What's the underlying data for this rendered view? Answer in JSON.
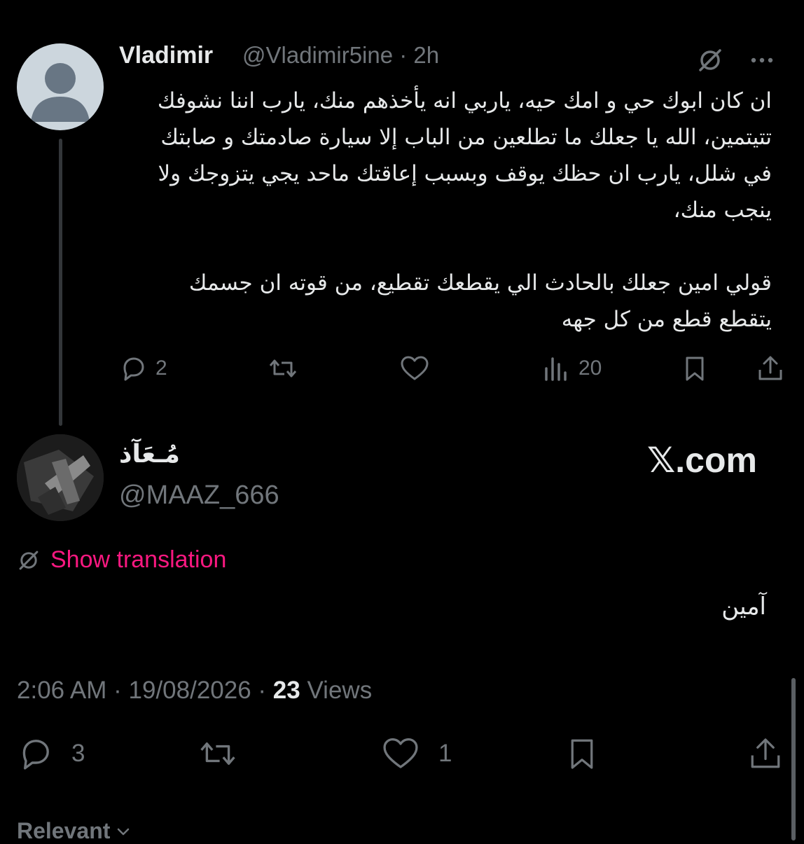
{
  "original_tweet": {
    "display_name": "Vladimir",
    "handle": "@Vladimir5ine · 2h",
    "text": "ان كان ابوك حي و امك حيه، ياربي انه يأخذهم منك، يارب اننا نشوفك تتيتمين، الله يا جعلك ما تطلعين من الباب إلا سيارة صادمتك و صابتك في شلل، يارب ان حظك يوقف وبسبب إعاقتك ماحد يجي يتزوجك ولا ينجب منك،\n\nقولي امين جعلك بالحادث الي يقطعك تقطيع، من قوته ان جسمك يتقطع قطع من كل جهه",
    "actions": {
      "replies": "2",
      "retweets": "",
      "likes": "",
      "views": "20"
    },
    "icons": [
      "no-translate-icon",
      "more-icon",
      "reply-icon",
      "retweet-icon",
      "like-icon",
      "views-icon",
      "bookmark-icon",
      "share-icon"
    ]
  },
  "reply_tweet": {
    "display_name": "مُـعَآذ",
    "handle": "@MAAZ_666",
    "watermark": "𝕏.com",
    "show_translation": "Show translation",
    "text": "آمين",
    "time": "2:06 AM · 19/08/2026 · ",
    "views_count": "23",
    "views_label": " Views",
    "actions": {
      "replies": "3",
      "retweets": "",
      "likes": "1"
    }
  },
  "sort": {
    "label": "Relevant"
  },
  "colors": {
    "background": "#000000",
    "text": "#e7e9ea",
    "muted": "#71767b",
    "accent_pink": "#f91880"
  }
}
